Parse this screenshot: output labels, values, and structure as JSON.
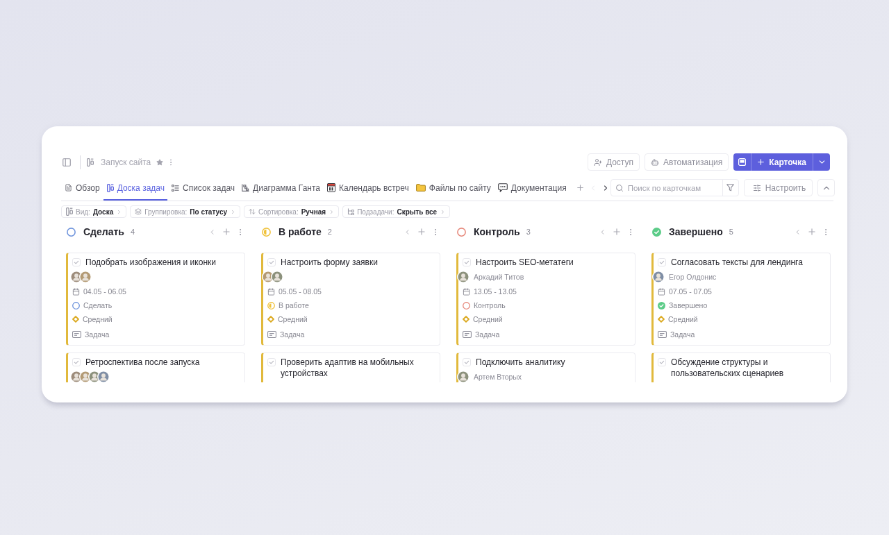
{
  "project": {
    "title": "Запуск сайта",
    "starred": true
  },
  "actions": [
    {
      "kind": "access",
      "label": "Доступ"
    },
    {
      "kind": "automation",
      "label": "Автоматизация"
    }
  ],
  "primary_action": {
    "label": "Карточка"
  },
  "tabs": [
    {
      "kind": "overview",
      "label": "Обзор",
      "selected": false
    },
    {
      "kind": "board",
      "label": "Доска задач",
      "selected": true
    },
    {
      "kind": "list",
      "label": "Список задач",
      "selected": false
    },
    {
      "kind": "gantt",
      "label": "Диаграмма Ганта",
      "selected": false
    },
    {
      "kind": "calendar",
      "label": "Календарь встреч",
      "selected": false
    },
    {
      "kind": "folder",
      "label": "Файлы по сайту",
      "selected": false
    },
    {
      "kind": "chat",
      "label": "Документация",
      "selected": false
    }
  ],
  "tab_scroll": [
    {
      "kind": "prev",
      "disabled": true
    },
    {
      "kind": "next",
      "disabled": false
    }
  ],
  "search": {
    "placeholder": "Поиск по карточкам"
  },
  "customize": {
    "label": "Настроить"
  },
  "filters": [
    {
      "kind": "view",
      "label": "Вид:",
      "value": "Доска"
    },
    {
      "kind": "grouping",
      "label": "Группировка:",
      "value": "По статусу"
    },
    {
      "kind": "sorting",
      "label": "Сортировка:",
      "value": "Ручная"
    },
    {
      "kind": "subtasks",
      "label": "Подзадачи:",
      "value": "Скрыть все"
    }
  ],
  "columns": [
    {
      "title": "Сделать",
      "count": "4",
      "kind": "todo",
      "cards": [
        {
          "title": "Подобрать изображения и иконки",
          "done": false,
          "avatars": [
            {
              "kind": "photo"
            },
            {
              "kind": "photo"
            }
          ],
          "dates": "04.05 - 06.05",
          "status": {
            "kind": "todo",
            "label": "Сделать"
          },
          "priority": {
            "kind": "medium",
            "label": "Средний"
          },
          "type": {
            "kind": "task",
            "label": "Задача"
          }
        },
        {
          "title": "Ретроспектива после запуска",
          "done": false,
          "avatars": [
            {
              "kind": "photo"
            },
            {
              "kind": "photo"
            },
            {
              "kind": "photo"
            },
            {
              "kind": "photo"
            }
          ]
        }
      ]
    },
    {
      "title": "В работе",
      "count": "2",
      "kind": "in_progress",
      "cards": [
        {
          "title": "Настроить форму заявки",
          "done": false,
          "avatars": [
            {
              "kind": "photo"
            },
            {
              "kind": "photo"
            }
          ],
          "dates": "05.05 - 08.05",
          "status": {
            "kind": "in_progress",
            "label": "В работе"
          },
          "priority": {
            "kind": "medium",
            "label": "Средний"
          },
          "type": {
            "kind": "task",
            "label": "Задача"
          }
        },
        {
          "title": "Проверить адаптив на мобильных устройствах",
          "done": false
        }
      ]
    },
    {
      "title": "Контроль",
      "count": "3",
      "kind": "review",
      "cards": [
        {
          "title": "Настроить SEO-метатеги",
          "done": false,
          "avatars": [
            {
              "kind": "photo"
            }
          ],
          "assignee": "Аркадий Титов",
          "dates": "13.05 - 13.05",
          "status": {
            "kind": "review",
            "label": "Контроль"
          },
          "priority": {
            "kind": "medium",
            "label": "Средний"
          },
          "type": {
            "kind": "task",
            "label": "Задача"
          }
        },
        {
          "title": "Подключить аналитику",
          "done": false,
          "avatars": [
            {
              "kind": "photo"
            }
          ],
          "assignee": "Артем Вторых"
        }
      ]
    },
    {
      "title": "Завершено",
      "count": "5",
      "kind": "done",
      "cards": [
        {
          "title": "Согласовать тексты для лендинга",
          "done": false,
          "avatars": [
            {
              "kind": "photo"
            }
          ],
          "assignee": "Егор Олдонис",
          "dates": "07.05 - 07.05",
          "status": {
            "kind": "done",
            "label": "Завершено"
          },
          "priority": {
            "kind": "medium",
            "label": "Средний"
          },
          "type": {
            "kind": "task",
            "label": "Задача"
          }
        },
        {
          "title": "Обсуждение структуры и пользовательских сценариев",
          "done": false
        }
      ]
    }
  ]
}
